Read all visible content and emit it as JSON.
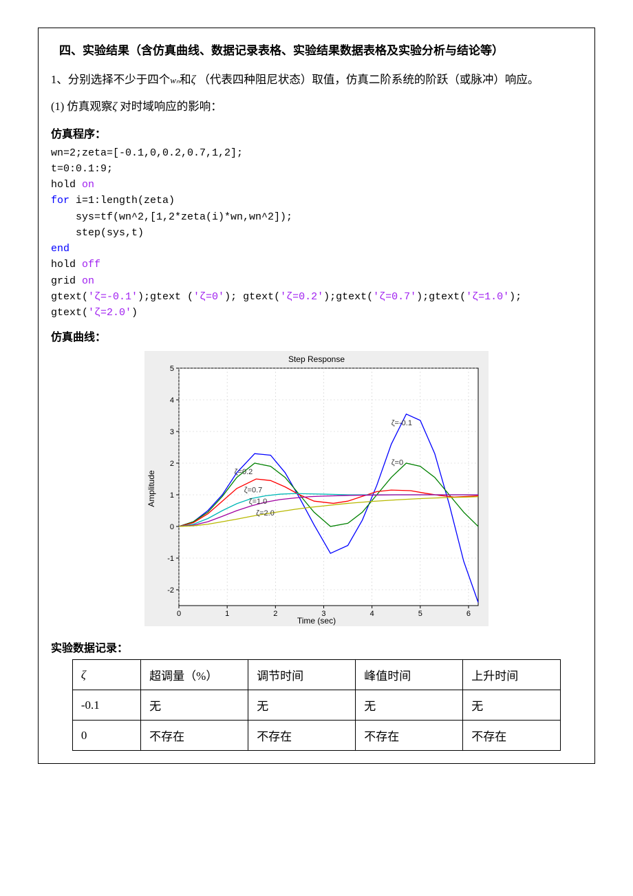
{
  "section_title": "四、实验结果（含仿真曲线、数据记录表格、实验结果数据表格及实验分析与结论等）",
  "para1_a": "1、分别选择不少于四个",
  "para1_wn": "wₙ",
  "para1_b": "和",
  "para1_c": "（代表四种阻尼状态）取值，仿真二阶系统的阶跃（或脉冲）响应。",
  "para2_a": "(1) 仿真观察",
  "para2_b": "对时域响应的影响：",
  "label_program": "仿真程序：",
  "code": {
    "l1": "wn=2;zeta=[-0.1,0,0.2,0.7,1,2];",
    "l2": "t=0:0.1:9;",
    "l3": "hold ",
    "l3b": "on",
    "l4": "for",
    "l4b": " i=1:length(zeta)",
    "l5": "    sys=tf(wn^2,[1,2*zeta(i)*wn,wn^2]);",
    "l6": "    step(sys,t)",
    "l7": "end",
    "l8": "hold ",
    "l8b": "off",
    "l9": "grid ",
    "l9b": "on",
    "l10a": "gtext(",
    "l10s1": "'ζ=-0.1'",
    "l10b": ");gtext (",
    "l10s2": "'ζ=0'",
    "l10c": "); gtext(",
    "l10s3": "'ζ=0.2'",
    "l10d": ");gtext(",
    "l10s4": "'ζ=0.7'",
    "l10e": ");gtext(",
    "l10s5": "'ζ=1.0'",
    "l10f": ");",
    "l11a": "gtext(",
    "l11s1": "'ζ=2.0'",
    "l11b": ")"
  },
  "label_curve": "仿真曲线：",
  "label_record": "实验数据记录：",
  "table": {
    "headers": [
      "ζ",
      "超调量（%）",
      "调节时间",
      "峰值时间",
      "上升时间"
    ],
    "rows": [
      [
        "-0.1",
        "无",
        "无",
        "无",
        "无"
      ],
      [
        "0",
        "不存在",
        "不存在",
        "不存在",
        "不存在"
      ]
    ]
  },
  "chart_data": {
    "type": "line",
    "title": "Step Response",
    "xlabel": "Time (sec)",
    "ylabel": "Amplitude",
    "xlim": [
      0,
      6.2
    ],
    "ylim": [
      -2.5,
      5
    ],
    "xticks": [
      0,
      1,
      2,
      3,
      4,
      5,
      6
    ],
    "yticks": [
      -2,
      -1,
      0,
      1,
      2,
      3,
      4,
      5
    ],
    "annotations": [
      {
        "text": "ζ=-0.1",
        "x": 4.4,
        "y": 3.2
      },
      {
        "text": "ζ=0",
        "x": 4.4,
        "y": 1.95
      },
      {
        "text": "ζ=0.2",
        "x": 1.15,
        "y": 1.65
      },
      {
        "text": "ζ=0.7",
        "x": 1.35,
        "y": 1.08
      },
      {
        "text": "ζ=1.0",
        "x": 1.45,
        "y": 0.72
      },
      {
        "text": "ζ=2.0",
        "x": 1.6,
        "y": 0.35
      }
    ],
    "series": [
      {
        "name": "ζ=-0.1",
        "color": "#0000ff",
        "x": [
          0,
          0.3,
          0.6,
          0.9,
          1.2,
          1.57,
          1.9,
          2.2,
          2.5,
          2.8,
          3.14,
          3.5,
          3.8,
          4.1,
          4.4,
          4.71,
          5.0,
          5.3,
          5.6,
          5.9,
          6.2
        ],
        "y": [
          0,
          0.15,
          0.5,
          1.0,
          1.7,
          2.3,
          2.25,
          1.7,
          0.9,
          0.05,
          -0.85,
          -0.6,
          0.2,
          1.3,
          2.6,
          3.55,
          3.35,
          2.3,
          0.7,
          -1.1,
          -2.4
        ]
      },
      {
        "name": "ζ=0",
        "color": "#008000",
        "x": [
          0,
          0.3,
          0.6,
          0.9,
          1.2,
          1.57,
          1.9,
          2.2,
          2.5,
          2.8,
          3.14,
          3.5,
          3.8,
          4.1,
          4.4,
          4.71,
          5.0,
          5.3,
          5.6,
          5.9,
          6.2
        ],
        "y": [
          0,
          0.15,
          0.45,
          0.95,
          1.55,
          2.0,
          1.9,
          1.55,
          1.0,
          0.45,
          0.0,
          0.1,
          0.45,
          1.0,
          1.55,
          2.0,
          1.9,
          1.55,
          1.0,
          0.45,
          0.0
        ]
      },
      {
        "name": "ζ=0.2",
        "color": "#ff0000",
        "x": [
          0,
          0.3,
          0.6,
          0.9,
          1.2,
          1.6,
          1.9,
          2.2,
          2.5,
          2.8,
          3.2,
          3.5,
          3.8,
          4.1,
          4.4,
          4.8,
          5.1,
          5.4,
          5.7,
          6.0,
          6.2
        ],
        "y": [
          0,
          0.12,
          0.4,
          0.8,
          1.2,
          1.5,
          1.45,
          1.25,
          1.0,
          0.8,
          0.73,
          0.8,
          0.95,
          1.1,
          1.15,
          1.13,
          1.05,
          0.98,
          0.93,
          0.95,
          0.97
        ]
      },
      {
        "name": "ζ=0.7",
        "color": "#00b7b7",
        "x": [
          0,
          0.3,
          0.6,
          0.9,
          1.2,
          1.5,
          1.8,
          2.1,
          2.4,
          2.7,
          3.0,
          3.5,
          4.0,
          4.5,
          5.0,
          5.5,
          6.0,
          6.2
        ],
        "y": [
          0,
          0.07,
          0.25,
          0.5,
          0.72,
          0.88,
          0.97,
          1.02,
          1.04,
          1.03,
          1.02,
          1.0,
          1.0,
          1.0,
          1.0,
          1.0,
          1.0,
          1.0
        ]
      },
      {
        "name": "ζ=1.0",
        "color": "#a000a0",
        "x": [
          0,
          0.3,
          0.6,
          0.9,
          1.2,
          1.5,
          1.8,
          2.1,
          2.4,
          2.7,
          3.0,
          3.5,
          4.0,
          4.5,
          5.0,
          5.5,
          6.0,
          6.2
        ],
        "y": [
          0,
          0.04,
          0.15,
          0.32,
          0.5,
          0.65,
          0.77,
          0.85,
          0.9,
          0.94,
          0.96,
          0.98,
          0.99,
          1.0,
          1.0,
          1.0,
          1.0,
          1.0
        ]
      },
      {
        "name": "ζ=2.0",
        "color": "#b8b800",
        "x": [
          0,
          0.3,
          0.6,
          0.9,
          1.2,
          1.5,
          1.8,
          2.1,
          2.4,
          2.7,
          3.0,
          3.5,
          4.0,
          4.5,
          5.0,
          5.5,
          6.0,
          6.2
        ],
        "y": [
          0,
          0.02,
          0.07,
          0.15,
          0.23,
          0.32,
          0.4,
          0.47,
          0.54,
          0.6,
          0.65,
          0.73,
          0.79,
          0.84,
          0.88,
          0.91,
          0.93,
          0.94
        ]
      }
    ]
  }
}
